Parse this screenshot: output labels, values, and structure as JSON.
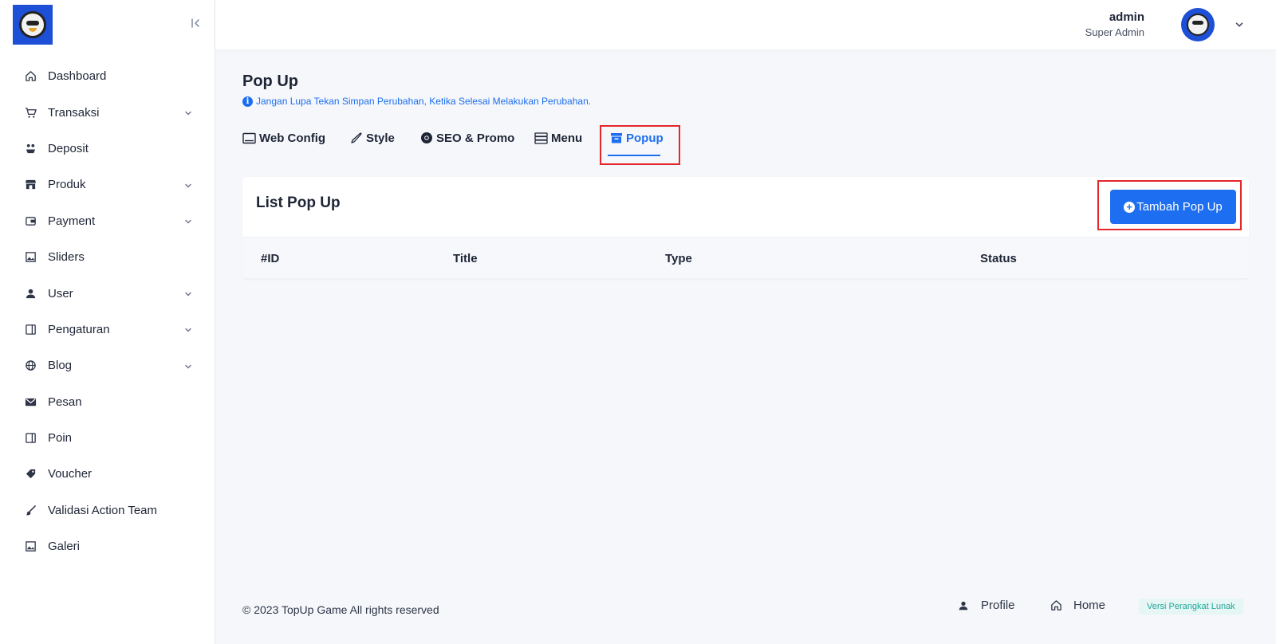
{
  "sidebar": {
    "items": [
      {
        "label": "Dashboard",
        "icon": "home-icon",
        "has_children": false
      },
      {
        "label": "Transaksi",
        "icon": "cart-icon",
        "has_children": true
      },
      {
        "label": "Deposit",
        "icon": "deposit-icon",
        "has_children": false
      },
      {
        "label": "Produk",
        "icon": "store-icon",
        "has_children": true
      },
      {
        "label": "Payment",
        "icon": "wallet-icon",
        "has_children": true
      },
      {
        "label": "Sliders",
        "icon": "image-icon",
        "has_children": false
      },
      {
        "label": "User",
        "icon": "user-icon",
        "has_children": true
      },
      {
        "label": "Pengaturan",
        "icon": "settings-panel-icon",
        "has_children": true
      },
      {
        "label": "Blog",
        "icon": "globe-icon",
        "has_children": true
      },
      {
        "label": "Pesan",
        "icon": "mail-icon",
        "has_children": false
      },
      {
        "label": "Poin",
        "icon": "points-icon",
        "has_children": false
      },
      {
        "label": "Voucher",
        "icon": "tag-icon",
        "has_children": false
      },
      {
        "label": "Validasi Action Team",
        "icon": "brush-icon",
        "has_children": false
      },
      {
        "label": "Galeri",
        "icon": "gallery-icon",
        "has_children": false
      }
    ]
  },
  "header": {
    "user_name": "admin",
    "user_role": "Super Admin"
  },
  "page": {
    "title": "Pop Up",
    "notice": "Jangan Lupa Tekan Simpan Perubahan, Ketika Selesai Melakukan Perubahan."
  },
  "tabs": [
    {
      "label": "Web Config",
      "icon": "monitor-icon"
    },
    {
      "label": "Style",
      "icon": "pen-icon"
    },
    {
      "label": "SEO & Promo",
      "icon": "chrome-icon"
    },
    {
      "label": "Menu",
      "icon": "server-icon"
    },
    {
      "label": "Popup",
      "icon": "archive-icon",
      "active": true
    }
  ],
  "card": {
    "title": "List Pop Up",
    "add_button": "Tambah Pop Up",
    "columns": [
      "#ID",
      "Title",
      "Type",
      "Status"
    ]
  },
  "footer": {
    "copyright": "© 2023 TopUp Game All rights reserved",
    "profile_link": "Profile",
    "home_link": "Home",
    "version": "Versi Perangkat Lunak"
  },
  "colors": {
    "primary": "#1d6ef0",
    "highlight": "#e3262b",
    "version_badge_bg": "#e6f6f5",
    "version_badge_text": "#1fa89a"
  }
}
